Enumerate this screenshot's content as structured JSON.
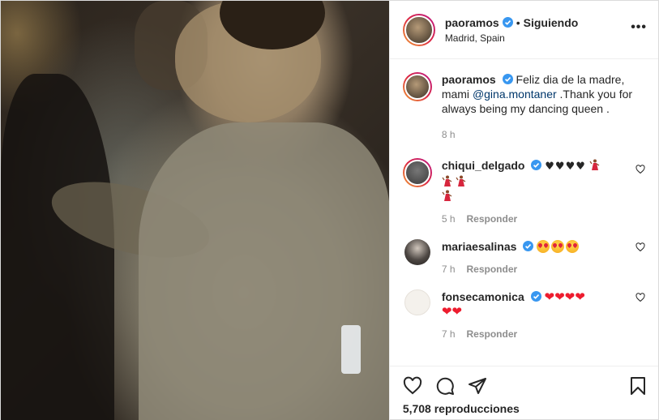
{
  "header": {
    "username": "paoramos",
    "separator": "•",
    "follow_status": "Siguiendo",
    "location": "Madrid, Spain",
    "more_label": "•••"
  },
  "caption": {
    "username": "paoramos",
    "text_before": "Feliz dia de la madre, mami ",
    "mention": "@gina.montaner",
    "text_after": " .Thank you for always being my dancing queen .",
    "time": "8 h"
  },
  "comments": [
    {
      "username": "chiqui_delgado",
      "text": "♥♥♥♥",
      "dancers": 4,
      "time": "5 h",
      "reply": "Responder"
    },
    {
      "username": "mariaesalinas",
      "emoji_count": 3,
      "time": "7 h",
      "reply": "Responder"
    },
    {
      "username": "fonsecamonica",
      "text": "❤❤❤❤",
      "text2": "❤❤",
      "time": "7 h",
      "reply": "Responder"
    }
  ],
  "footer": {
    "views": "5,708 reproducciones"
  },
  "colors": {
    "verified": "#3897f0",
    "heart": "#ed1c2e",
    "mention": "#00376b",
    "meta": "#8e8e8e"
  }
}
